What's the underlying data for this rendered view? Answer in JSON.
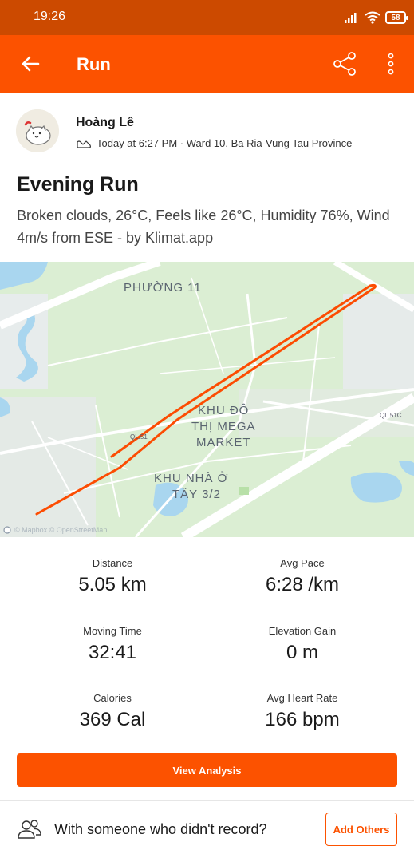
{
  "status_bar": {
    "time": "19:26",
    "battery": "58"
  },
  "app_bar": {
    "title": "Run"
  },
  "athlete": {
    "name": "Hoàng Lê",
    "meta": "Today at 6:27 PM · Ward 10, Ba Ria-Vung Tau Province"
  },
  "activity": {
    "title": "Evening Run",
    "description": "Broken clouds, 26°C, Feels like 26°C, Humidity 76%, Wind 4m/s from ESE - by Klimat.app"
  },
  "map": {
    "labels": {
      "ward": "PHƯỜNG 11",
      "mega_1": "KHU ĐÔ",
      "mega_2": "THỊ MEGA",
      "mega_3": "MARKET",
      "tay_1": "KHU NHÀ Ở",
      "tay_2": "TÂY 3/2",
      "road": "QL.51C",
      "road_small": "QL.51",
      "attribution": "© Mapbox © OpenStreetMap"
    },
    "route_color": "#fc4c02"
  },
  "stats": [
    {
      "left": {
        "label": "Distance",
        "value": "5.05 km"
      },
      "right": {
        "label": "Avg Pace",
        "value": "6:28 /km"
      }
    },
    {
      "left": {
        "label": "Moving Time",
        "value": "32:41"
      },
      "right": {
        "label": "Elevation Gain",
        "value": "0 m"
      }
    },
    {
      "left": {
        "label": "Calories",
        "value": "369 Cal"
      },
      "right": {
        "label": "Avg Heart Rate",
        "value": "166 bpm"
      }
    }
  ],
  "actions": {
    "view_analysis": "View Analysis",
    "others_prompt": "With someone who didn't record?",
    "add_others": "Add Others"
  },
  "colors": {
    "brand": "#fc5200",
    "status_bar": "#cc4a00",
    "map_land": "#dbeed3",
    "map_water": "#a9d6ef"
  },
  "icons": [
    "back-arrow-icon",
    "share-icon",
    "more-vertical-icon",
    "shoe-icon",
    "people-icon",
    "mapbox-icon",
    "wifi-icon",
    "signal-icon",
    "battery-icon"
  ]
}
